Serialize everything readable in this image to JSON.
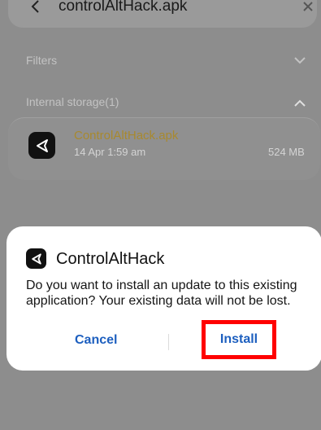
{
  "search_bar": {
    "query": "controlAltHack.apk",
    "back_icon": "back-arrow-icon",
    "clear_icon": "close-icon"
  },
  "sections": {
    "filters_label": "Filters",
    "storage_label": "Internal storage(1)"
  },
  "file": {
    "name": "ControlAltHack.apk",
    "date": "14 Apr 1:59 am",
    "size": "524 MB",
    "icon": "unity-app-icon"
  },
  "dialog": {
    "app_name": "ControlAltHack",
    "message": "Do you want to install an update to this existing application? Your existing data will not be lost.",
    "cancel_label": "Cancel",
    "install_label": "Install",
    "button_color": "#1d5fbf",
    "highlight_color": "#ff0000"
  }
}
